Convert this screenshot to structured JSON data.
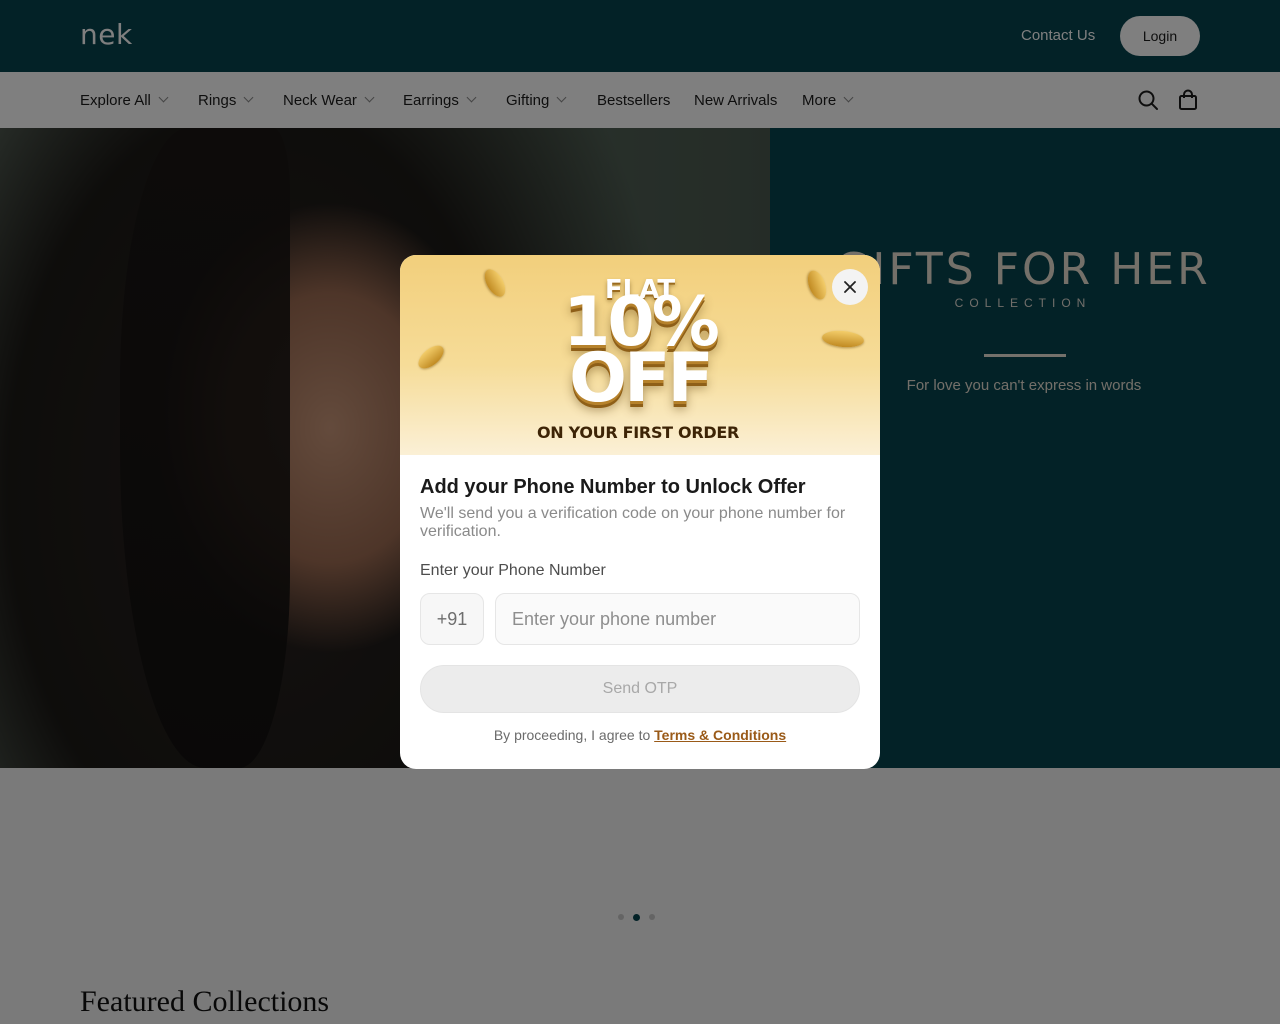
{
  "header": {
    "logo": "nek",
    "contact_label": "Contact Us",
    "login_label": "Login"
  },
  "nav": {
    "items": [
      {
        "label": "Explore All",
        "dropdown": true
      },
      {
        "label": "Rings",
        "dropdown": true
      },
      {
        "label": "Neck Wear",
        "dropdown": true
      },
      {
        "label": "Earrings",
        "dropdown": true
      },
      {
        "label": "Gifting",
        "dropdown": true
      },
      {
        "label": "Bestsellers",
        "dropdown": false
      },
      {
        "label": "New Arrivals",
        "dropdown": false
      },
      {
        "label": "More",
        "dropdown": true
      }
    ],
    "icons": [
      "search-icon",
      "shopping-bag-icon"
    ]
  },
  "hero": {
    "title": "GIFTS FOR HER",
    "subtitle": "COLLECTION",
    "tagline": "For love you can't express in words",
    "slides_total": 3,
    "active_slide": 2
  },
  "sections": {
    "featured_title": "Featured Collections"
  },
  "modal": {
    "banner_flat": "FLAT",
    "banner_percent": "10%",
    "banner_off": "OFF",
    "banner_sub": "ON YOUR FIRST ORDER",
    "title": "Add your Phone Number to Unlock Offer",
    "description": "We'll send you a verification code on your phone number for verification.",
    "phone_label": "Enter your Phone Number",
    "country_code": "+91",
    "phone_placeholder": "Enter your phone number",
    "phone_value": "",
    "otp_button": "Send OTP",
    "terms_prefix": "By proceeding, I agree to",
    "terms_link": "Terms & Conditions"
  },
  "colors": {
    "brand_teal": "#06444f",
    "banner_gold": "#f2cf7c",
    "link_brown": "#9a5a18"
  }
}
